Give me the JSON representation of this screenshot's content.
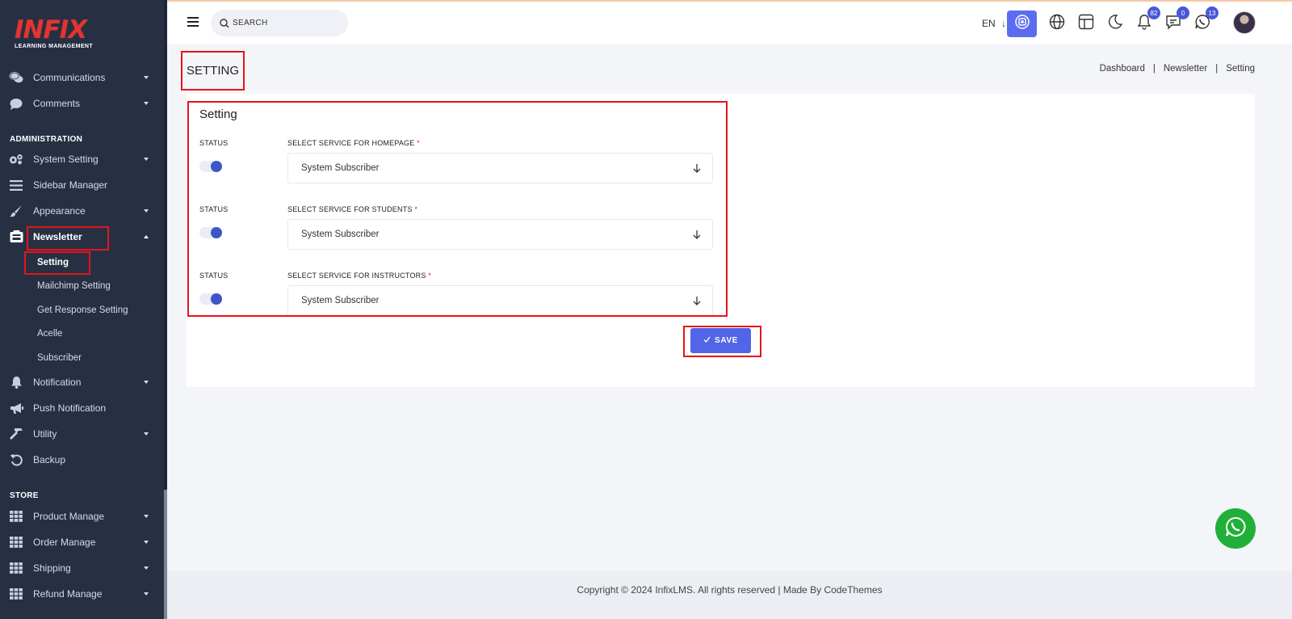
{
  "brand": {
    "logo_text": "INFIX",
    "tagline": "LEARNING MANAGEMENT"
  },
  "sidebar": {
    "items_top": [
      {
        "label": "Communications",
        "icon": "chat-bubbles-icon"
      },
      {
        "label": "Comments",
        "icon": "comment-icon"
      }
    ],
    "section_admin": "ADMINISTRATION",
    "items_admin": [
      {
        "label": "System Setting",
        "icon": "gears-icon"
      },
      {
        "label": "Sidebar Manager",
        "icon": "bars-icon"
      },
      {
        "label": "Appearance",
        "icon": "brush-icon"
      },
      {
        "label": "Newsletter",
        "icon": "newsletter-icon"
      }
    ],
    "newsletter_sub": [
      "Setting",
      "Mailchimp Setting",
      "Get Response Setting",
      "Acelle",
      "Subscriber"
    ],
    "items_after": [
      {
        "label": "Notification",
        "icon": "bell-icon"
      },
      {
        "label": "Push Notification",
        "icon": "megaphone-icon"
      },
      {
        "label": "Utility",
        "icon": "hammer-icon"
      },
      {
        "label": "Backup",
        "icon": "undo-icon"
      }
    ],
    "section_store": "STORE",
    "items_store": [
      {
        "label": "Product Manage",
        "icon": "grid-icon"
      },
      {
        "label": "Order Manage",
        "icon": "grid-icon"
      },
      {
        "label": "Shipping",
        "icon": "grid-icon"
      },
      {
        "label": "Refund Manage",
        "icon": "grid-icon"
      }
    ]
  },
  "topbar": {
    "search_placeholder": "SEARCH",
    "language": "EN",
    "notifications_count": "82",
    "messages_count": "0",
    "chats_count": "13"
  },
  "page": {
    "title": "SETTING",
    "breadcrumb": [
      "Dashboard",
      "Newsletter",
      "Setting"
    ]
  },
  "card": {
    "title": "Setting",
    "rows": [
      {
        "status_label": "STATUS",
        "select_label": "SELECT SERVICE FOR HOMEPAGE",
        "value": "System Subscriber"
      },
      {
        "status_label": "STATUS",
        "select_label": "SELECT SERVICE FOR STUDENTS",
        "value": "System Subscriber"
      },
      {
        "status_label": "STATUS",
        "select_label": "SELECT SERVICE FOR INSTRUCTORS",
        "value": "System Subscriber"
      }
    ],
    "save_label": "SAVE",
    "required_mark": "*"
  },
  "footer": {
    "text": "Copyright © 2024 InfixLMS. All rights reserved | Made By CodeThemes"
  },
  "colors": {
    "sidebar_bg": "#273043",
    "accent": "#5265e8",
    "highlight": "#e4141b",
    "whatsapp": "#20b038"
  }
}
